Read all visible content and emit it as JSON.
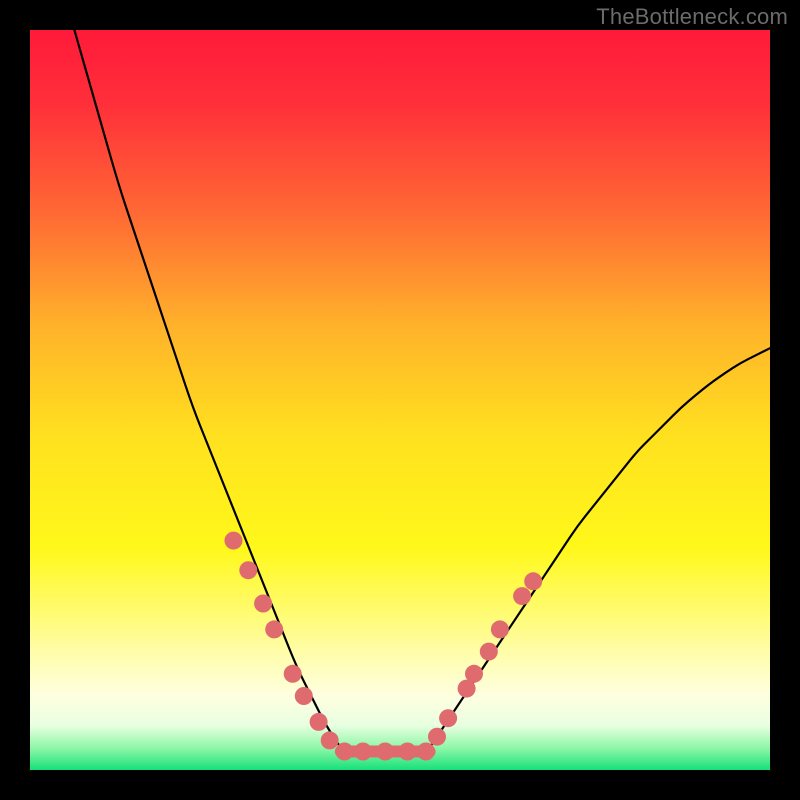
{
  "watermark": "TheBottleneck.com",
  "chart_data": {
    "type": "line",
    "title": "",
    "xlabel": "",
    "ylabel": "",
    "xlim": [
      0,
      100
    ],
    "ylim": [
      0,
      100
    ],
    "background_gradient": {
      "stops": [
        {
          "offset": 0.0,
          "color": "#ff1a3a"
        },
        {
          "offset": 0.1,
          "color": "#ff2f3a"
        },
        {
          "offset": 0.25,
          "color": "#ff6a34"
        },
        {
          "offset": 0.4,
          "color": "#ffb22a"
        },
        {
          "offset": 0.55,
          "color": "#ffe11f"
        },
        {
          "offset": 0.7,
          "color": "#fff81a"
        },
        {
          "offset": 0.78,
          "color": "#fffb6a"
        },
        {
          "offset": 0.84,
          "color": "#fffda8"
        },
        {
          "offset": 0.9,
          "color": "#feffe0"
        },
        {
          "offset": 0.94,
          "color": "#e8ffe0"
        },
        {
          "offset": 0.97,
          "color": "#8ff7a7"
        },
        {
          "offset": 1.0,
          "color": "#17e07a"
        }
      ]
    },
    "series": [
      {
        "name": "left-branch",
        "stroke": "#000000",
        "x": [
          6,
          8,
          10,
          12,
          14,
          16,
          18,
          20,
          22,
          24,
          26,
          28,
          30,
          32,
          34,
          36,
          38,
          40,
          42
        ],
        "y": [
          100,
          93,
          86,
          79,
          73,
          67,
          61,
          55,
          49,
          44,
          39,
          34,
          29,
          24,
          19,
          14,
          10,
          6,
          3
        ]
      },
      {
        "name": "right-branch",
        "stroke": "#000000",
        "x": [
          54,
          56,
          58,
          60,
          62,
          64,
          66,
          68,
          70,
          72,
          74,
          76,
          78,
          80,
          82,
          84,
          86,
          88,
          90,
          92,
          94,
          96,
          98,
          100
        ],
        "y": [
          3,
          6,
          9,
          12,
          15,
          18,
          21,
          24,
          27,
          30,
          33,
          35.5,
          38,
          40.5,
          43,
          45,
          47,
          49,
          50.7,
          52.3,
          53.7,
          55,
          56,
          57
        ]
      },
      {
        "name": "flat-bottom",
        "stroke": "#e06b6e",
        "stroke_width": 12,
        "x": [
          42,
          54
        ],
        "y": [
          2.5,
          2.5
        ]
      }
    ],
    "scatter": {
      "name": "markers",
      "color": "#e06b6e",
      "radius": 9,
      "points": [
        {
          "x": 27.5,
          "y": 31
        },
        {
          "x": 29.5,
          "y": 27
        },
        {
          "x": 31.5,
          "y": 22.5
        },
        {
          "x": 33.0,
          "y": 19
        },
        {
          "x": 35.5,
          "y": 13
        },
        {
          "x": 37.0,
          "y": 10
        },
        {
          "x": 39.0,
          "y": 6.5
        },
        {
          "x": 40.5,
          "y": 4
        },
        {
          "x": 42.5,
          "y": 2.5
        },
        {
          "x": 45.0,
          "y": 2.5
        },
        {
          "x": 48.0,
          "y": 2.5
        },
        {
          "x": 51.0,
          "y": 2.5
        },
        {
          "x": 53.5,
          "y": 2.5
        },
        {
          "x": 55.0,
          "y": 4.5
        },
        {
          "x": 56.5,
          "y": 7
        },
        {
          "x": 59.0,
          "y": 11
        },
        {
          "x": 60.0,
          "y": 13
        },
        {
          "x": 62.0,
          "y": 16
        },
        {
          "x": 63.5,
          "y": 19
        },
        {
          "x": 66.5,
          "y": 23.5
        },
        {
          "x": 68.0,
          "y": 25.5
        }
      ]
    }
  }
}
